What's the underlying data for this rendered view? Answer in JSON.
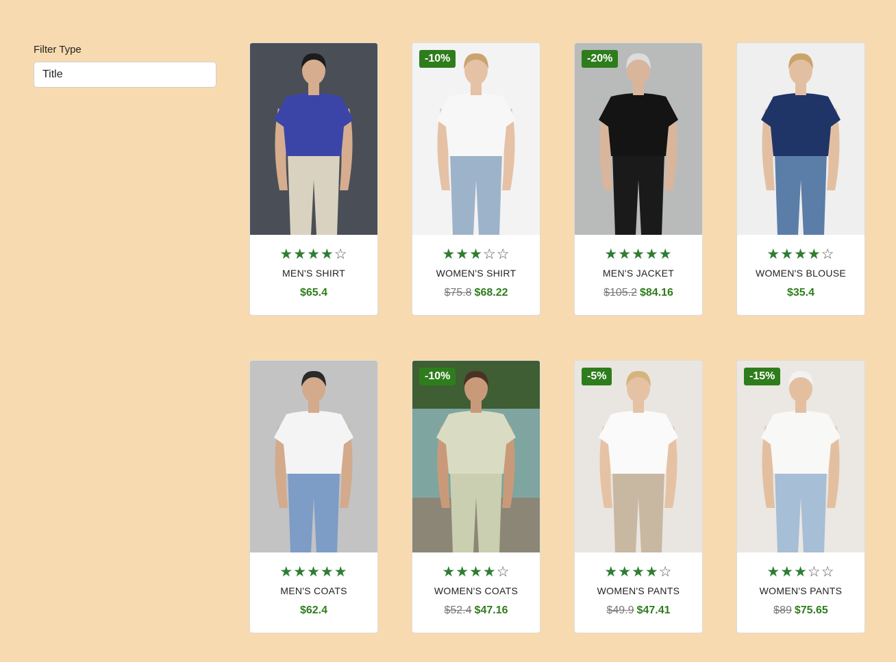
{
  "filter": {
    "label": "Filter Type",
    "value": "Title"
  },
  "products": [
    {
      "title": "MEN'S SHIRT",
      "rating": 4,
      "badge": "",
      "old_price": "",
      "price": "$65.4",
      "image": "man in blue polo shirt and sunglasses",
      "colors": {
        "bg": "#4a4f57",
        "top": "#3b45a8",
        "bottom": "#d9d2c0",
        "skin": "#d6ad8f",
        "hair": "#1c1c1c"
      }
    },
    {
      "title": "WOMEN'S SHIRT",
      "rating": 3,
      "badge": "-10%",
      "old_price": "$75.8",
      "price": "$68.22",
      "image": "woman in white graphic tee and jeans",
      "colors": {
        "bg": "#f3f3f3",
        "top": "#f7f7f7",
        "bottom": "#9db3c9",
        "skin": "#e5c1a6",
        "hair": "#caa36f"
      }
    },
    {
      "title": "MEN'S JACKET",
      "rating": 5,
      "badge": "-20%",
      "old_price": "$105.2",
      "price": "$84.16",
      "image": "man in black tee and cap",
      "colors": {
        "bg": "#b9bbbb",
        "top": "#141414",
        "bottom": "#1a1a1a",
        "skin": "#d9b59c",
        "hair": "#dcdcdc"
      }
    },
    {
      "title": "WOMEN'S BLOUSE",
      "rating": 4,
      "badge": "",
      "old_price": "",
      "price": "$35.4",
      "image": "woman in navy tee and blue jeans",
      "colors": {
        "bg": "#efefef",
        "top": "#1f3568",
        "bottom": "#5b7ea8",
        "skin": "#e3bfa2",
        "hair": "#c9a46b"
      }
    },
    {
      "title": "MEN'S COATS",
      "rating": 5,
      "badge": "",
      "old_price": "",
      "price": "$62.4",
      "image": "man in white polo and blue shorts",
      "colors": {
        "bg": "#c3c3c3",
        "top": "#f4f4f4",
        "bottom": "#7d9cc6",
        "skin": "#d3aa8c",
        "hair": "#2a2a2a"
      }
    },
    {
      "title": "WOMEN'S COATS",
      "rating": 4,
      "badge": "-10%",
      "old_price": "$52.4",
      "price": "$47.16",
      "image": "woman in floral dress by the water",
      "colors": {
        "bg": "#5e7f5a",
        "top": "#d9dcc2",
        "bottom": "#c9cfb0",
        "skin": "#c99a79",
        "hair": "#4a3322"
      }
    },
    {
      "title": "WOMEN'S PANTS",
      "rating": 4,
      "badge": "-5%",
      "old_price": "$49.9",
      "price": "$47.41",
      "image": "woman in white top and beige pants",
      "colors": {
        "bg": "#e9e6e2",
        "top": "#fafafa",
        "bottom": "#c8b8a2",
        "skin": "#e6c2a4",
        "hair": "#d6b47e"
      }
    },
    {
      "title": "WOMEN'S PANTS",
      "rating": 3,
      "badge": "-15%",
      "old_price": "$89",
      "price": "$75.65",
      "image": "woman in white shirt and patterned pants",
      "colors": {
        "bg": "#ebe7e2",
        "top": "#f8f8f6",
        "bottom": "#a6bed6",
        "skin": "#e3bfa0",
        "hair": "#f2f2f2"
      }
    }
  ]
}
